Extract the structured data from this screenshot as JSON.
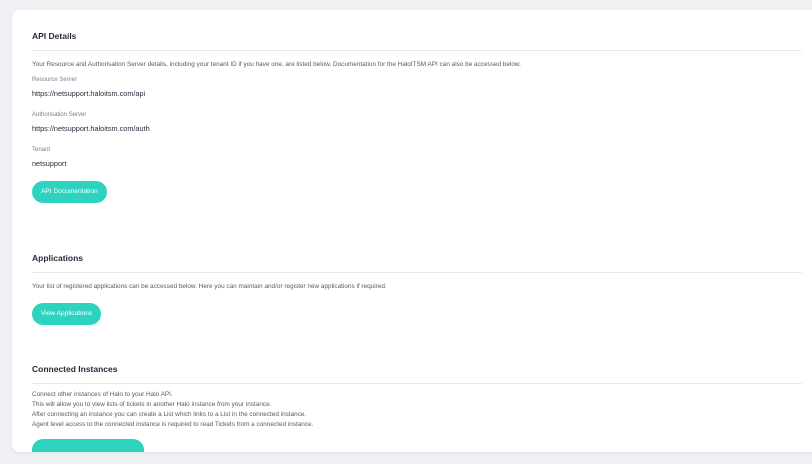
{
  "api_details": {
    "title": "API Details",
    "description": "Your Resource and Authorisation Server details, including your tenant ID if you have one, are listed below. Documentation for the HaloITSM API can also be accessed below.",
    "resource_server_label": "Resource Server",
    "resource_server_value": "https://netsupport.haloitsm.com/api",
    "authorisation_server_label": "Authorisation Server",
    "authorisation_server_value": "https://netsupport.haloitsm.com/auth",
    "tenant_label": "Tenant",
    "tenant_value": "netsupport",
    "button_label": "API Documentation"
  },
  "applications": {
    "title": "Applications",
    "description": "Your list of registered applications can be accessed below. Here you can maintain and/or register new applications if required.",
    "button_label": "View Applications"
  },
  "connected_instances": {
    "title": "Connected Instances",
    "lines": [
      "Connect other instances of Halo to your Halo API.",
      "This will allow you to view lists of tickets in another Halo instance from your instance.",
      "After connecting an instance you can create a List which links to a List in the connected instance.",
      "Agent level access to the connected instance is required to read Tickets from a connected instance."
    ]
  },
  "colors": {
    "accent": "#2ed3c0",
    "background": "#eef0f3"
  }
}
